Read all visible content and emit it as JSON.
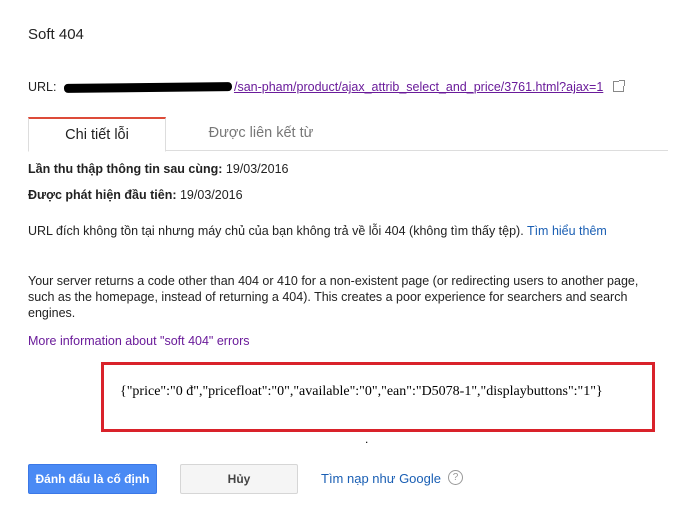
{
  "page": {
    "title": "Soft 404"
  },
  "url": {
    "label": "URL:",
    "visible_path": "/san-pham/product/ajax_attrib_select_and_price/3761.html?ajax=1"
  },
  "tabs": [
    {
      "label": "Chi tiết lỗi",
      "active": true
    },
    {
      "label": "Được liên kết từ",
      "active": false
    }
  ],
  "details": {
    "last_crawled_label": "Lần thu thập thông tin sau cùng:",
    "last_crawled_value": "19/03/2016",
    "first_detected_label": "Được phát hiện đầu tiên:",
    "first_detected_value": "19/03/2016"
  },
  "description": {
    "vi_text": "URL đích không tồn tại nhưng máy chủ của bạn không trả về lỗi 404 (không tìm thấy tệp).",
    "learn_more": "Tìm hiểu thêm",
    "en_text": "Your server returns a code other than 404 or 410 for a non-existent page (or redirecting users to another page, such as the homepage, instead of returning a 404). This creates a poor experience for searchers and search engines.",
    "more_info_link": "More information about \"soft 404\" errors"
  },
  "response_box": {
    "json_text": "{\"price\":\"0 đ\",\"pricefloat\":\"0\",\"available\":\"0\",\"ean\":\"D5078-1\",\"displaybuttons\":\"1\"}",
    "border_color": "#d9222a"
  },
  "dot": ".",
  "actions": {
    "mark_fixed": "Đánh dấu là cố định",
    "cancel": "Hủy",
    "fetch_as_google": "Tìm nạp như Google",
    "help_symbol": "?"
  },
  "colors": {
    "primary_button": "#4a8af4",
    "link_blue": "#1a5fb4",
    "link_visited": "#6a1b9a",
    "active_tab_accent": "#dd4b39"
  }
}
